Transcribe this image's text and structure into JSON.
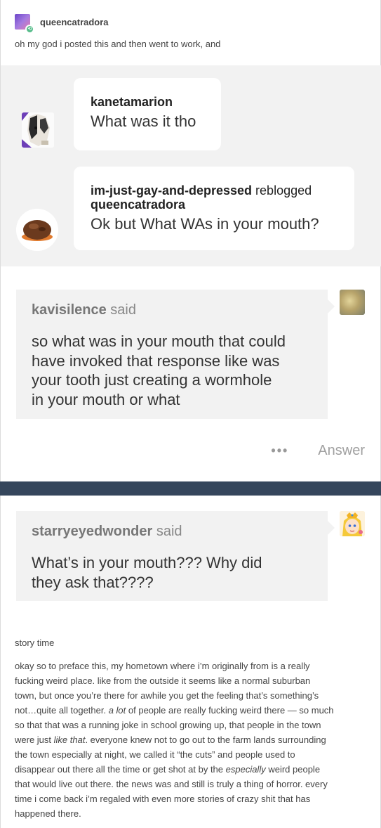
{
  "post": {
    "author": "queencatradora",
    "caption": "oh my god i posted this and then went to work, and"
  },
  "chat": [
    {
      "name": "kanetamarion",
      "suffix": "",
      "second_name": "",
      "text": "What was it tho"
    },
    {
      "name": "im-just-gay-and-depressed",
      "suffix": " reblogged",
      "second_name": "queencatradora",
      "text": "Ok but What WAs in your mouth?"
    }
  ],
  "ask1": {
    "asker": "kavisilence",
    "said": " said",
    "lines": [
      "so what was in your mouth that could",
      "have invoked that response like was",
      "your tooth just creating a wormhole",
      "in your mouth or what"
    ]
  },
  "actions": {
    "more": "•••",
    "answer": "Answer"
  },
  "ask2": {
    "asker": "starryeyedwonder",
    "said": " said",
    "lines": [
      "What’s in your mouth??? Why did",
      "they ask that????"
    ]
  },
  "story": {
    "title": "story time",
    "lines": [
      "okay so to preface this, my hometown where i’m originally from is a really",
      "fucking weird place. like from the outside it seems like a normal suburban",
      "town, but once you’re there for awhile you get the feeling that’s something’s",
      "not…quite all together. ",
      "a lot",
      " of people are really fucking weird there — so much",
      "so that that was a running joke in school growing up, that people in the town",
      "were just ",
      "like that",
      ". everyone knew not to go out to the farm lands surrounding",
      "the town especially at night, we called it “the cuts” and people used to",
      "disappear out there all the time or get shot at by the ",
      "especially",
      " weird people",
      "that would live out there. the news was and still is truly a thing of horror. every",
      "time i come back i’m regaled with even more stories of crazy shit that has",
      "happened there."
    ]
  },
  "colors": {
    "background": "#35465c",
    "panel": "#f2f2f2",
    "reblog_badge": "#56bc8a"
  },
  "icons": [
    "reblog-icon",
    "more-icon"
  ]
}
